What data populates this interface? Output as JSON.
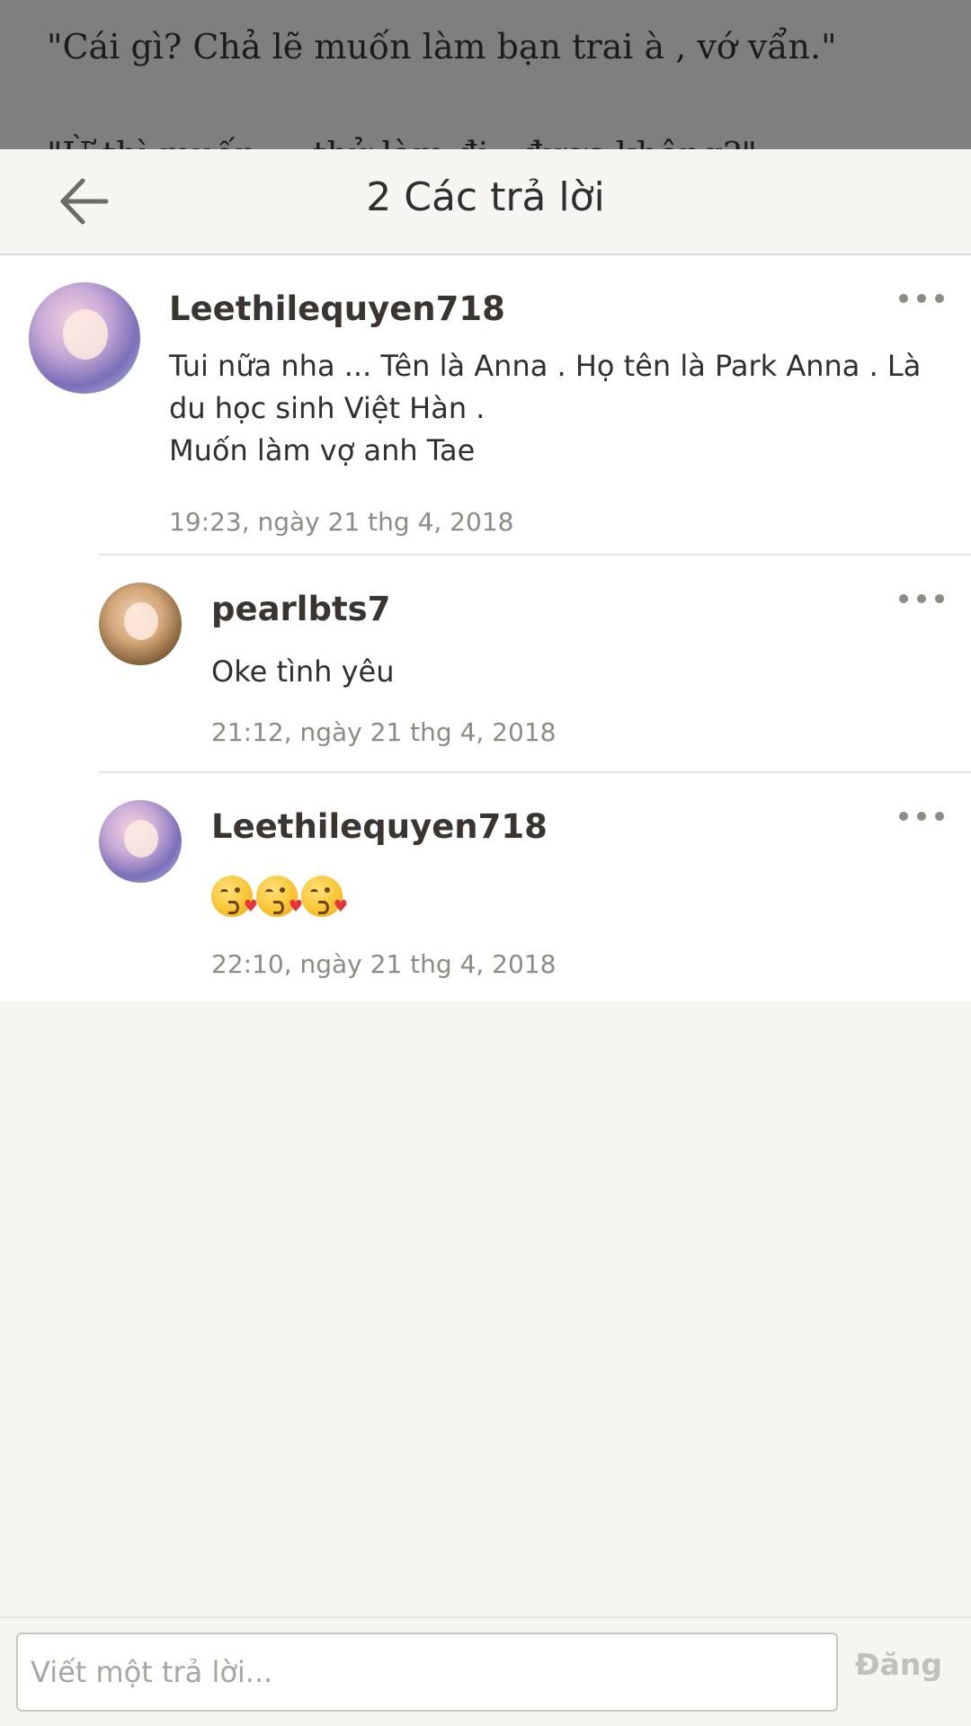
{
  "story": {
    "line1": "\"Cái gì? Chả lẽ muốn làm bạn trai à , vớ vẩn.\"",
    "line2": "\"Ừ thì muốn … thử làm đi , được không?\""
  },
  "header": {
    "title": "2 Các trả lời",
    "back_icon": "arrow-left-icon"
  },
  "comments": [
    {
      "username": "Leethilequyen718",
      "text": "Tui nữa nha ... Tên là Anna . Họ tên là Park Anna . Là du học sinh Việt Hàn .\nMuốn làm vợ anh Tae",
      "timestamp": "19:23, ngày 21 thg 4, 2018"
    },
    {
      "username": "pearlbts7",
      "text": "Oke tình yêu",
      "timestamp": "21:12, ngày 21 thg 4, 2018"
    },
    {
      "username": "Leethilequyen718",
      "emoji": "😘😘😘",
      "timestamp": "22:10, ngày 21 thg 4, 2018"
    }
  ],
  "compose": {
    "placeholder": "Viết một trả lời...",
    "post_label": "Đăng"
  },
  "colors": {
    "overlay": "#7f7f7f",
    "sheet_bg": "#f6f5f2",
    "text": "#2f2f2f",
    "muted": "#8e8a84",
    "post_disabled": "#c3bfb9"
  }
}
